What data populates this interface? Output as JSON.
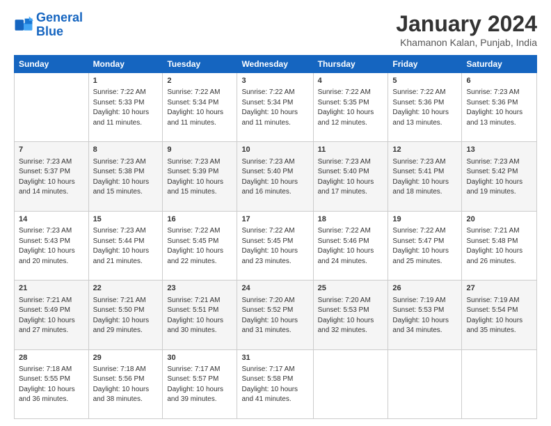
{
  "logo": {
    "line1": "General",
    "line2": "Blue"
  },
  "header": {
    "title": "January 2024",
    "subtitle": "Khamanon Kalan, Punjab, India"
  },
  "columns": [
    "Sunday",
    "Monday",
    "Tuesday",
    "Wednesday",
    "Thursday",
    "Friday",
    "Saturday"
  ],
  "weeks": [
    [
      {
        "day": "",
        "info": ""
      },
      {
        "day": "1",
        "info": "Sunrise: 7:22 AM\nSunset: 5:33 PM\nDaylight: 10 hours\nand 11 minutes."
      },
      {
        "day": "2",
        "info": "Sunrise: 7:22 AM\nSunset: 5:34 PM\nDaylight: 10 hours\nand 11 minutes."
      },
      {
        "day": "3",
        "info": "Sunrise: 7:22 AM\nSunset: 5:34 PM\nDaylight: 10 hours\nand 11 minutes."
      },
      {
        "day": "4",
        "info": "Sunrise: 7:22 AM\nSunset: 5:35 PM\nDaylight: 10 hours\nand 12 minutes."
      },
      {
        "day": "5",
        "info": "Sunrise: 7:22 AM\nSunset: 5:36 PM\nDaylight: 10 hours\nand 13 minutes."
      },
      {
        "day": "6",
        "info": "Sunrise: 7:23 AM\nSunset: 5:36 PM\nDaylight: 10 hours\nand 13 minutes."
      }
    ],
    [
      {
        "day": "7",
        "info": "Sunrise: 7:23 AM\nSunset: 5:37 PM\nDaylight: 10 hours\nand 14 minutes."
      },
      {
        "day": "8",
        "info": "Sunrise: 7:23 AM\nSunset: 5:38 PM\nDaylight: 10 hours\nand 15 minutes."
      },
      {
        "day": "9",
        "info": "Sunrise: 7:23 AM\nSunset: 5:39 PM\nDaylight: 10 hours\nand 15 minutes."
      },
      {
        "day": "10",
        "info": "Sunrise: 7:23 AM\nSunset: 5:40 PM\nDaylight: 10 hours\nand 16 minutes."
      },
      {
        "day": "11",
        "info": "Sunrise: 7:23 AM\nSunset: 5:40 PM\nDaylight: 10 hours\nand 17 minutes."
      },
      {
        "day": "12",
        "info": "Sunrise: 7:23 AM\nSunset: 5:41 PM\nDaylight: 10 hours\nand 18 minutes."
      },
      {
        "day": "13",
        "info": "Sunrise: 7:23 AM\nSunset: 5:42 PM\nDaylight: 10 hours\nand 19 minutes."
      }
    ],
    [
      {
        "day": "14",
        "info": "Sunrise: 7:23 AM\nSunset: 5:43 PM\nDaylight: 10 hours\nand 20 minutes."
      },
      {
        "day": "15",
        "info": "Sunrise: 7:23 AM\nSunset: 5:44 PM\nDaylight: 10 hours\nand 21 minutes."
      },
      {
        "day": "16",
        "info": "Sunrise: 7:22 AM\nSunset: 5:45 PM\nDaylight: 10 hours\nand 22 minutes."
      },
      {
        "day": "17",
        "info": "Sunrise: 7:22 AM\nSunset: 5:45 PM\nDaylight: 10 hours\nand 23 minutes."
      },
      {
        "day": "18",
        "info": "Sunrise: 7:22 AM\nSunset: 5:46 PM\nDaylight: 10 hours\nand 24 minutes."
      },
      {
        "day": "19",
        "info": "Sunrise: 7:22 AM\nSunset: 5:47 PM\nDaylight: 10 hours\nand 25 minutes."
      },
      {
        "day": "20",
        "info": "Sunrise: 7:21 AM\nSunset: 5:48 PM\nDaylight: 10 hours\nand 26 minutes."
      }
    ],
    [
      {
        "day": "21",
        "info": "Sunrise: 7:21 AM\nSunset: 5:49 PM\nDaylight: 10 hours\nand 27 minutes."
      },
      {
        "day": "22",
        "info": "Sunrise: 7:21 AM\nSunset: 5:50 PM\nDaylight: 10 hours\nand 29 minutes."
      },
      {
        "day": "23",
        "info": "Sunrise: 7:21 AM\nSunset: 5:51 PM\nDaylight: 10 hours\nand 30 minutes."
      },
      {
        "day": "24",
        "info": "Sunrise: 7:20 AM\nSunset: 5:52 PM\nDaylight: 10 hours\nand 31 minutes."
      },
      {
        "day": "25",
        "info": "Sunrise: 7:20 AM\nSunset: 5:53 PM\nDaylight: 10 hours\nand 32 minutes."
      },
      {
        "day": "26",
        "info": "Sunrise: 7:19 AM\nSunset: 5:53 PM\nDaylight: 10 hours\nand 34 minutes."
      },
      {
        "day": "27",
        "info": "Sunrise: 7:19 AM\nSunset: 5:54 PM\nDaylight: 10 hours\nand 35 minutes."
      }
    ],
    [
      {
        "day": "28",
        "info": "Sunrise: 7:18 AM\nSunset: 5:55 PM\nDaylight: 10 hours\nand 36 minutes."
      },
      {
        "day": "29",
        "info": "Sunrise: 7:18 AM\nSunset: 5:56 PM\nDaylight: 10 hours\nand 38 minutes."
      },
      {
        "day": "30",
        "info": "Sunrise: 7:17 AM\nSunset: 5:57 PM\nDaylight: 10 hours\nand 39 minutes."
      },
      {
        "day": "31",
        "info": "Sunrise: 7:17 AM\nSunset: 5:58 PM\nDaylight: 10 hours\nand 41 minutes."
      },
      {
        "day": "",
        "info": ""
      },
      {
        "day": "",
        "info": ""
      },
      {
        "day": "",
        "info": ""
      }
    ]
  ]
}
